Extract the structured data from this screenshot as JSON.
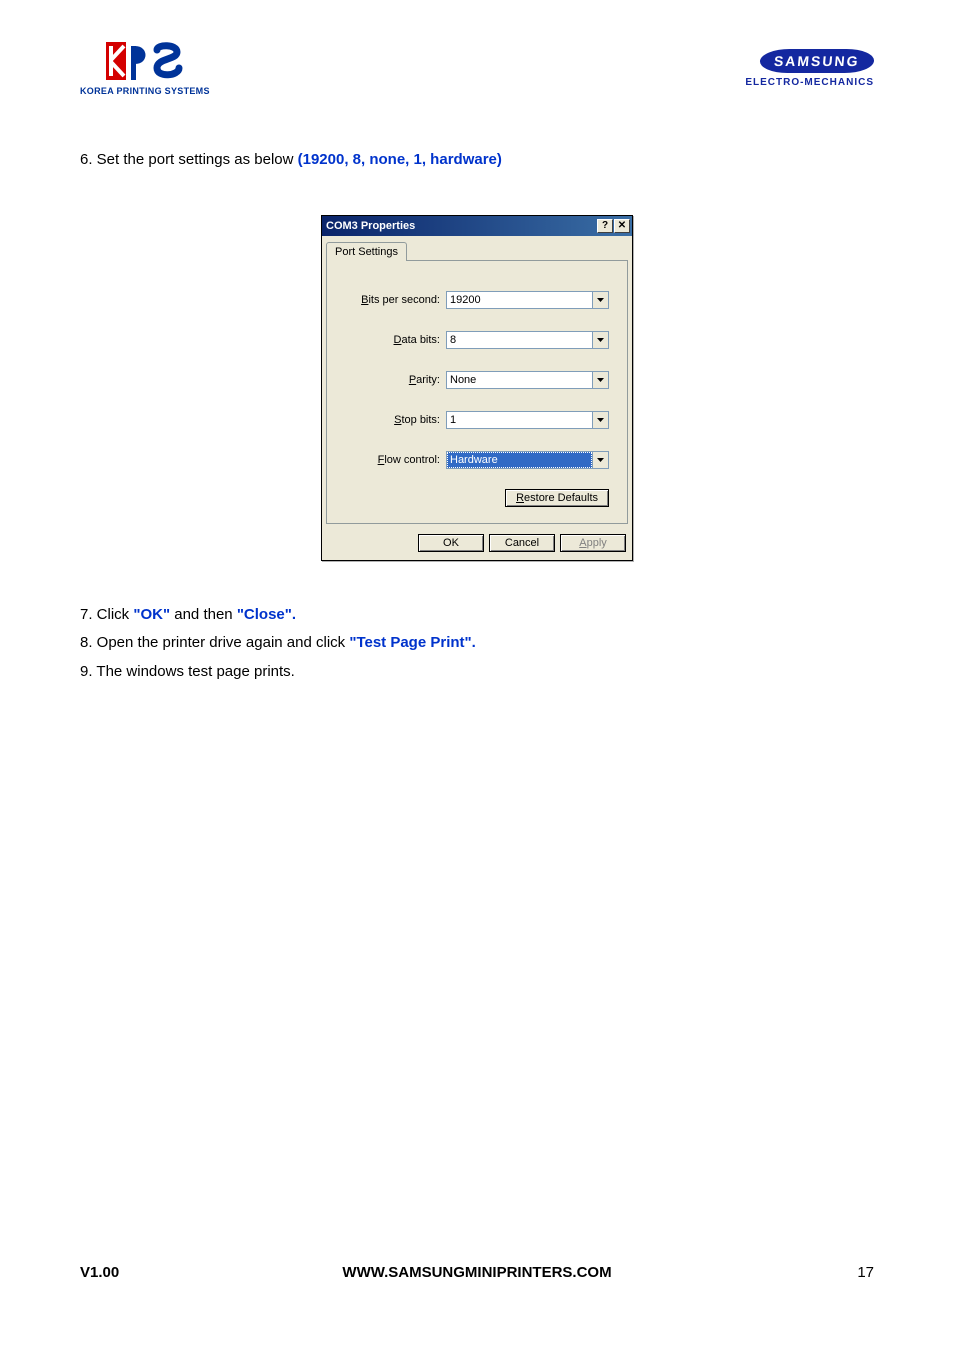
{
  "header": {
    "logo_kps_sub": "KOREA PRINTING SYSTEMS",
    "samsung": "SAMSUNG",
    "samsung_sub": "ELECTRO-MECHANICS"
  },
  "instructions": {
    "step6_prefix": "6. Set the port settings as below ",
    "step6_blue": "(19200, 8, none, 1, hardware)",
    "step7_prefix": "7. Click ",
    "step7_ok": "\"OK\"",
    "step7_mid": " and then ",
    "step7_close": "\"Close\".",
    "step8_prefix": "8. Open the printer drive again and click ",
    "step8_blue": "\"Test Page Print\".",
    "step9": "9. The windows test page prints."
  },
  "dialog": {
    "title": "COM3 Properties",
    "help_btn": "?",
    "close_btn": "✕",
    "tab": "Port Settings",
    "fields": {
      "bps_u": "B",
      "bps_rest": "its per second:",
      "data_u": "D",
      "data_rest": "ata bits:",
      "parity_u": "P",
      "parity_rest": "arity:",
      "stop_u": "S",
      "stop_rest": "top bits:",
      "flow_u": "F",
      "flow_rest": "low control:"
    },
    "values": {
      "bps": "19200",
      "data": "8",
      "parity": "None",
      "stop": "1",
      "flow": "Hardware"
    },
    "restore_u": "R",
    "restore_rest": "estore Defaults",
    "ok": "OK",
    "cancel": "Cancel",
    "apply_u": "A",
    "apply_rest": "pply"
  },
  "footer": {
    "version": "V1.00",
    "url": "WWW.SAMSUNGMINIPRINTERS.COM",
    "page": "17"
  }
}
